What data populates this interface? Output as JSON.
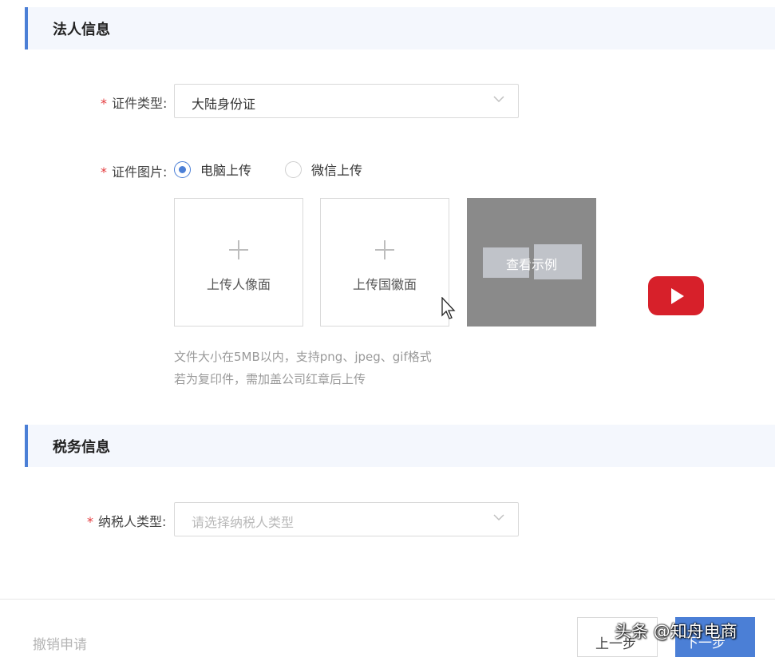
{
  "legal_person": {
    "section_title": "法人信息",
    "id_type": {
      "label": "证件类型:",
      "value": "大陆身份证"
    },
    "id_images": {
      "label": "证件图片:",
      "upload_options": [
        "电脑上传",
        "微信上传"
      ],
      "selected_option": "电脑上传",
      "front_upload_label": "上传人像面",
      "back_upload_label": "上传国徽面",
      "example_label": "查看示例",
      "hint_line_1": "文件大小在5MB以内，支持png、jpeg、gif格式",
      "hint_line_2": "若为复印件，需加盖公司红章后上传"
    }
  },
  "tax": {
    "section_title": "税务信息",
    "taxpayer_type": {
      "label": "纳税人类型:",
      "placeholder": "请选择纳税人类型"
    }
  },
  "footer": {
    "cancel_label": "撤销申请",
    "prev_label": "上一步",
    "next_label": "下一步",
    "watermark": "头条 @知舟电商"
  },
  "colors": {
    "accent": "#4b7fd6",
    "required": "#e4393c",
    "play": "#d7202a"
  },
  "icons": {
    "video": "play-icon",
    "dropdown": "chevron-down-icon",
    "cursor": "mouse-cursor-icon"
  }
}
